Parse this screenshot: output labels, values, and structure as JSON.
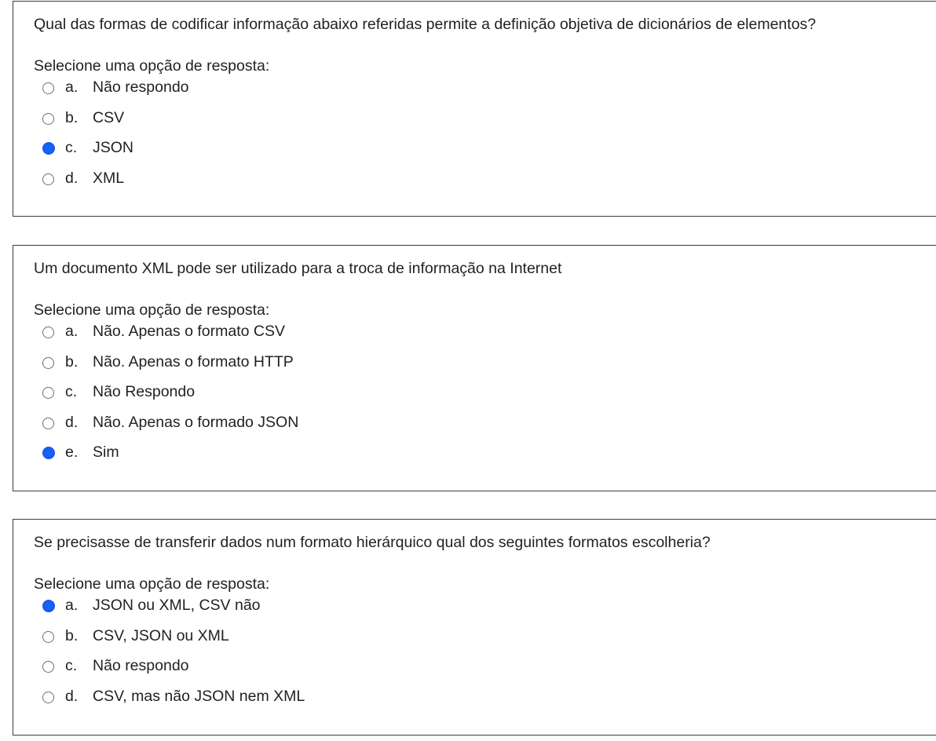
{
  "prompt_label": "Selecione uma opção de resposta:",
  "questions": [
    {
      "text": "Qual das formas de codificar informação abaixo referidas permite a definição objetiva de dicionários de elementos?",
      "options": [
        {
          "letter": "a.",
          "label": "Não respondo",
          "selected": false
        },
        {
          "letter": "b.",
          "label": "CSV",
          "selected": false
        },
        {
          "letter": "c.",
          "label": "JSON",
          "selected": true
        },
        {
          "letter": "d.",
          "label": "XML",
          "selected": false
        }
      ]
    },
    {
      "text": "Um documento XML pode ser utilizado para a troca de informação na Internet",
      "options": [
        {
          "letter": "a.",
          "label": "Não. Apenas o formato CSV",
          "selected": false
        },
        {
          "letter": "b.",
          "label": "Não. Apenas o formato HTTP",
          "selected": false
        },
        {
          "letter": "c.",
          "label": "Não Respondo",
          "selected": false
        },
        {
          "letter": "d.",
          "label": "Não. Apenas o formado JSON",
          "selected": false
        },
        {
          "letter": "e.",
          "label": "Sim",
          "selected": true
        }
      ]
    },
    {
      "text": "Se precisasse de transferir dados num formato hierárquico qual dos seguintes formatos escolheria?",
      "options": [
        {
          "letter": "a.",
          "label": "JSON ou XML, CSV não",
          "selected": true
        },
        {
          "letter": "b.",
          "label": "CSV, JSON ou XML",
          "selected": false
        },
        {
          "letter": "c.",
          "label": "Não respondo",
          "selected": false
        },
        {
          "letter": "d.",
          "label": "CSV, mas não JSON nem XML",
          "selected": false
        }
      ]
    }
  ],
  "colors": {
    "radio_selected": "#1a5bf5",
    "radio_border": "#6e6e6e",
    "card_border": "#3c3c3c",
    "text": "#1d2125"
  }
}
